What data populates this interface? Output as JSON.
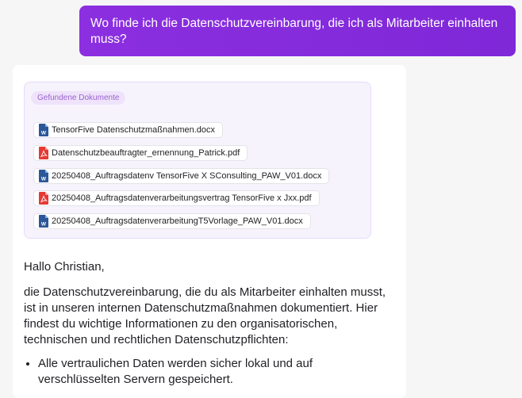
{
  "user_message": {
    "text": "Wo finde ich die Datenschutzvereinbarung, die ich als Mitarbeiter einhalten muss?"
  },
  "documents_panel": {
    "title": "Gefundene Dokumente",
    "documents": [
      {
        "name": "TensorFive Datenschutzmaßnahmen.docx",
        "icon": "word-file-icon",
        "color": "#2b579a"
      },
      {
        "name": "Datenschutzbeauftragter_ernennung_Patrick.pdf",
        "icon": "pdf-file-icon",
        "color": "#e53935"
      },
      {
        "name": "20250408_Auftragsdatenv TensorFive X SConsulting_PAW_V01.docx",
        "icon": "word-file-icon",
        "color": "#2b579a"
      },
      {
        "name": "20250408_Auftragsdatenverarbeitungsvertrag TensorFive x Jxx.pdf",
        "icon": "pdf-file-icon",
        "color": "#e53935"
      },
      {
        "name": "20250408_AuftragsdatenverarbeitungT5Vorlage_PAW_V01.docx",
        "icon": "word-file-icon",
        "color": "#2b579a"
      }
    ]
  },
  "assistant_message": {
    "greeting": "Hallo Christian,",
    "intro": "die Datenschutzvereinbarung, die du als Mitarbeiter einhalten musst, ist in unseren internen Datenschutzmaßnahmen dokumentiert. Hier findest du wichtige Informationen zu den organisatorischen, technischen und rechtlichen Datenschutzpflichten:",
    "bullets": [
      "Alle vertraulichen Daten werden sicher lokal und auf verschlüsselten Servern gespeichert."
    ]
  },
  "colors": {
    "user_bubble": "#8a2be2",
    "badge_text": "#9a62cf",
    "panel_background": "#f7f3fd"
  }
}
